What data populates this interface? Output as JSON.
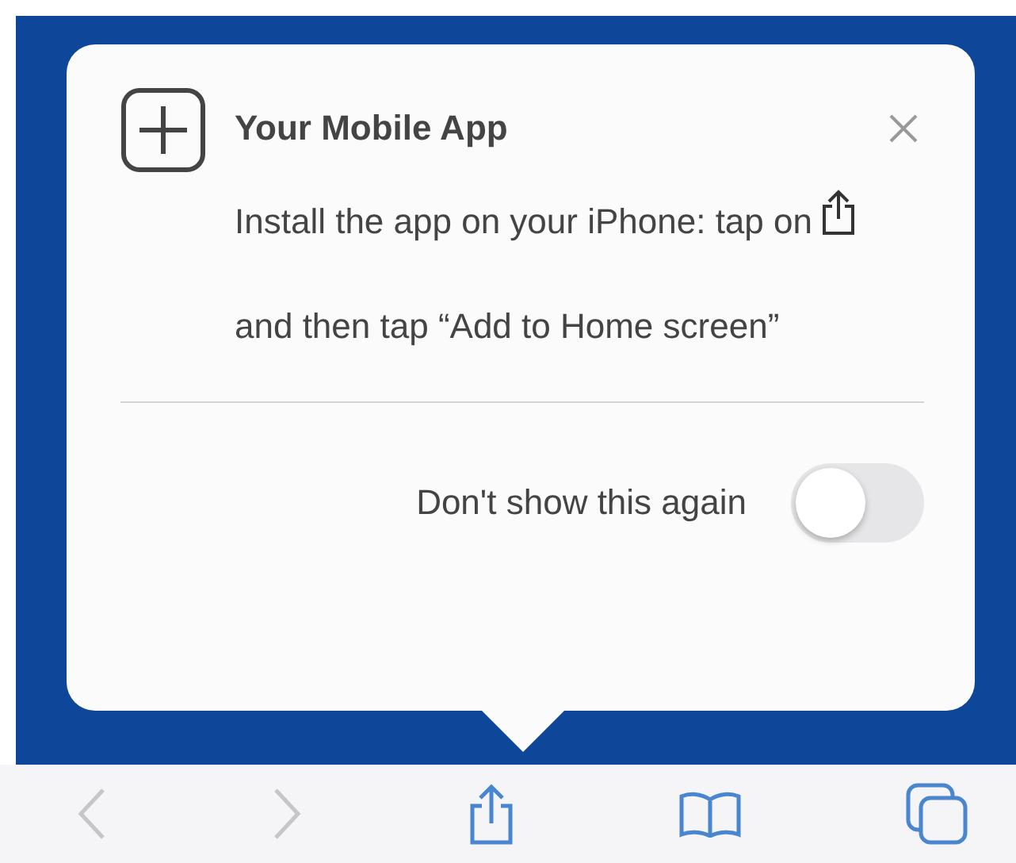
{
  "popup": {
    "title": "Your Mobile App",
    "instruction_before": "Install the app on your iPhone: tap on",
    "instruction_after": "and then tap “Add to Home screen”",
    "toggle": {
      "label": "Don't show this again",
      "on": false
    }
  },
  "toolbar": [
    {
      "kind": "back",
      "disabled": true
    },
    {
      "kind": "forward",
      "disabled": true
    },
    {
      "kind": "share",
      "disabled": false
    },
    {
      "kind": "bookmarks",
      "disabled": false
    },
    {
      "kind": "tabs",
      "disabled": false
    }
  ]
}
